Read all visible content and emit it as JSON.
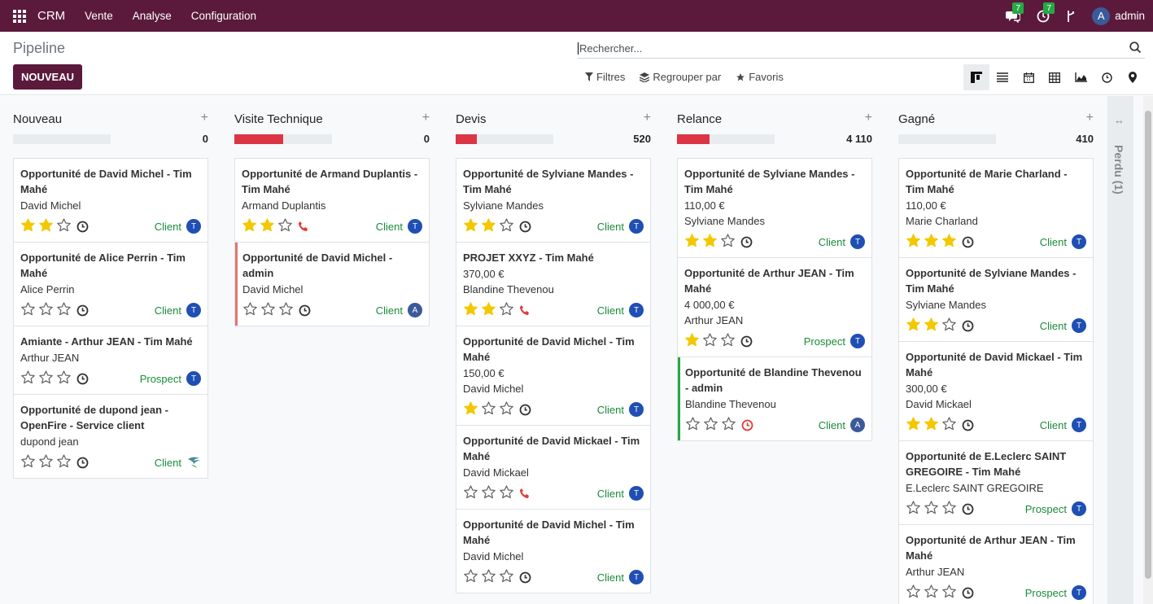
{
  "navbar": {
    "app_name": "CRM",
    "menu": [
      "Vente",
      "Analyse",
      "Configuration"
    ],
    "messages_count": "7",
    "activities_count": "7",
    "user_initial": "A",
    "user_name": "admin"
  },
  "control": {
    "title": "Pipeline",
    "new_button": "NOUVEAU",
    "search_placeholder": "Rechercher...",
    "filters_label": "Filtres",
    "group_by_label": "Regrouper par",
    "favorites_label": "Favoris"
  },
  "columns": [
    {
      "title": "Nouveau",
      "total": "0",
      "progress": 0,
      "cards": [
        {
          "title": "Opportunité de David Michel - Tim Mahé",
          "lines": [
            "David Michel"
          ],
          "stars": 2,
          "activity": "clock",
          "tag": "Client",
          "avatar": "T",
          "accent": ""
        },
        {
          "title": "Opportunité de Alice Perrin - Tim Mahé",
          "lines": [
            "Alice Perrin"
          ],
          "stars": 0,
          "activity": "clock",
          "tag": "Client",
          "avatar": "T",
          "accent": ""
        },
        {
          "title": "Amiante - Arthur JEAN - Tim Mahé",
          "lines": [
            "Arthur JEAN"
          ],
          "stars": 0,
          "activity": "clock",
          "tag": "Prospect",
          "avatar": "T",
          "accent": ""
        },
        {
          "title": "Opportunité de dupond jean - OpenFire - Service client",
          "lines": [
            "dupond jean"
          ],
          "stars": 0,
          "activity": "clock",
          "tag": "Client",
          "avatar": "logo",
          "accent": ""
        }
      ]
    },
    {
      "title": "Visite Technique",
      "total": "0",
      "progress": 0.5,
      "cards": [
        {
          "title": "Opportunité de Armand Duplantis - Tim Mahé",
          "lines": [
            "Armand Duplantis"
          ],
          "stars": 2,
          "activity": "phone",
          "tag": "Client",
          "avatar": "T",
          "accent": ""
        },
        {
          "title": "Opportunité de David Michel - admin",
          "lines": [
            "David Michel"
          ],
          "stars": 0,
          "activity": "clock",
          "tag": "Client",
          "avatar": "A",
          "accent": "red"
        }
      ]
    },
    {
      "title": "Devis",
      "total": "520",
      "progress": 0.22,
      "cards": [
        {
          "title": "Opportunité de Sylviane Mandes - Tim Mahé",
          "lines": [
            "Sylviane Mandes"
          ],
          "stars": 2,
          "activity": "clock",
          "tag": "Client",
          "avatar": "T",
          "accent": ""
        },
        {
          "title": "PROJET XXYZ - Tim Mahé",
          "lines": [
            "370,00 €",
            "Blandine Thevenou"
          ],
          "stars": 2,
          "activity": "phone",
          "tag": "Client",
          "avatar": "T",
          "accent": ""
        },
        {
          "title": "Opportunité de David Michel - Tim Mahé",
          "lines": [
            "150,00 €",
            "David Michel"
          ],
          "stars": 1,
          "activity": "clock",
          "tag": "Client",
          "avatar": "T",
          "accent": ""
        },
        {
          "title": "Opportunité de David Mickael - Tim Mahé",
          "lines": [
            "David Mickael"
          ],
          "stars": 0,
          "activity": "phone",
          "tag": "Client",
          "avatar": "T",
          "accent": ""
        },
        {
          "title": "Opportunité de David Michel - Tim Mahé",
          "lines": [
            "David Michel"
          ],
          "stars": 0,
          "activity": "clock",
          "tag": "Client",
          "avatar": "T",
          "accent": ""
        }
      ]
    },
    {
      "title": "Relance",
      "total": "4 110",
      "progress": 0.33,
      "cards": [
        {
          "title": "Opportunité de Sylviane Mandes - Tim Mahé",
          "lines": [
            "110,00 €",
            "Sylviane Mandes"
          ],
          "stars": 2,
          "activity": "clock",
          "tag": "Client",
          "avatar": "T",
          "accent": ""
        },
        {
          "title": "Opportunité de Arthur JEAN - Tim Mahé",
          "lines": [
            "4 000,00 €",
            "Arthur JEAN"
          ],
          "stars": 1,
          "activity": "clock",
          "tag": "Prospect",
          "avatar": "T",
          "accent": ""
        },
        {
          "title": "Opportunité de Blandine Thevenou - admin",
          "lines": [
            "Blandine Thevenou"
          ],
          "stars": 0,
          "activity": "clock-red",
          "tag": "Client",
          "avatar": "A",
          "accent": "green"
        }
      ]
    },
    {
      "title": "Gagné",
      "total": "410",
      "progress": 0,
      "cards": [
        {
          "title": "Opportunité de Marie Charland - Tim Mahé",
          "lines": [
            "110,00 €",
            "Marie Charland"
          ],
          "stars": 3,
          "activity": "clock",
          "tag": "Client",
          "avatar": "T",
          "accent": ""
        },
        {
          "title": "Opportunité de Sylviane Mandes - Tim Mahé",
          "lines": [
            "Sylviane Mandes"
          ],
          "stars": 2,
          "activity": "clock",
          "tag": "Client",
          "avatar": "T",
          "accent": ""
        },
        {
          "title": "Opportunité de David Mickael - Tim Mahé",
          "lines": [
            "300,00 €",
            "David Mickael"
          ],
          "stars": 2,
          "activity": "clock",
          "tag": "Client",
          "avatar": "T",
          "accent": ""
        },
        {
          "title": "Opportunité de E.Leclerc SAINT GREGOIRE - Tim Mahé",
          "lines": [
            "E.Leclerc SAINT GREGOIRE"
          ],
          "stars": 0,
          "activity": "clock",
          "tag": "Prospect",
          "avatar": "T",
          "accent": ""
        },
        {
          "title": "Opportunité de Arthur JEAN - Tim Mahé",
          "lines": [
            "Arthur JEAN"
          ],
          "stars": 0,
          "activity": "clock",
          "tag": "Prospect",
          "avatar": "T",
          "accent": ""
        }
      ]
    }
  ],
  "folded_column": {
    "label": "Perdu (1)"
  },
  "colors": {
    "brand": "#5b1a3c",
    "star": "#f3c800",
    "progress": "#dc3545",
    "tag": "#1a8a3a",
    "avatar": "#1f4fb3"
  }
}
